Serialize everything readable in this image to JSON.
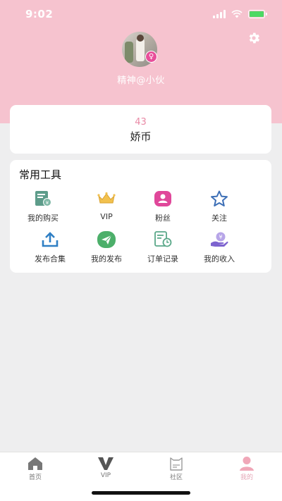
{
  "status_bar": {
    "time": "9:02"
  },
  "profile": {
    "nickname": "精神@小伙"
  },
  "coins": {
    "value": "43",
    "label": "娇币"
  },
  "tools": {
    "title": "常用工具",
    "items": [
      {
        "label": "我的购买",
        "icon": "purchase-receipt-icon"
      },
      {
        "label": "VIP",
        "icon": "crown-icon"
      },
      {
        "label": "粉丝",
        "icon": "fans-icon"
      },
      {
        "label": "关注",
        "icon": "star-icon"
      },
      {
        "label": "发布合集",
        "icon": "upload-icon"
      },
      {
        "label": "我的发布",
        "icon": "paper-plane-icon"
      },
      {
        "label": "订单记录",
        "icon": "order-record-icon"
      },
      {
        "label": "我的收入",
        "icon": "income-icon"
      }
    ]
  },
  "tabbar": {
    "items": [
      {
        "label": "首页",
        "icon": "home-icon"
      },
      {
        "label": "VIP",
        "icon": "vip-v-icon"
      },
      {
        "label": "社区",
        "icon": "community-icon"
      },
      {
        "label": "我的",
        "icon": "profile-icon",
        "active": true
      }
    ]
  },
  "colors": {
    "header_pink": "#f6c3cf",
    "coin_value": "#e98aa6",
    "active_tab": "#e5a6b6",
    "page_bg": "#eeeeef"
  }
}
